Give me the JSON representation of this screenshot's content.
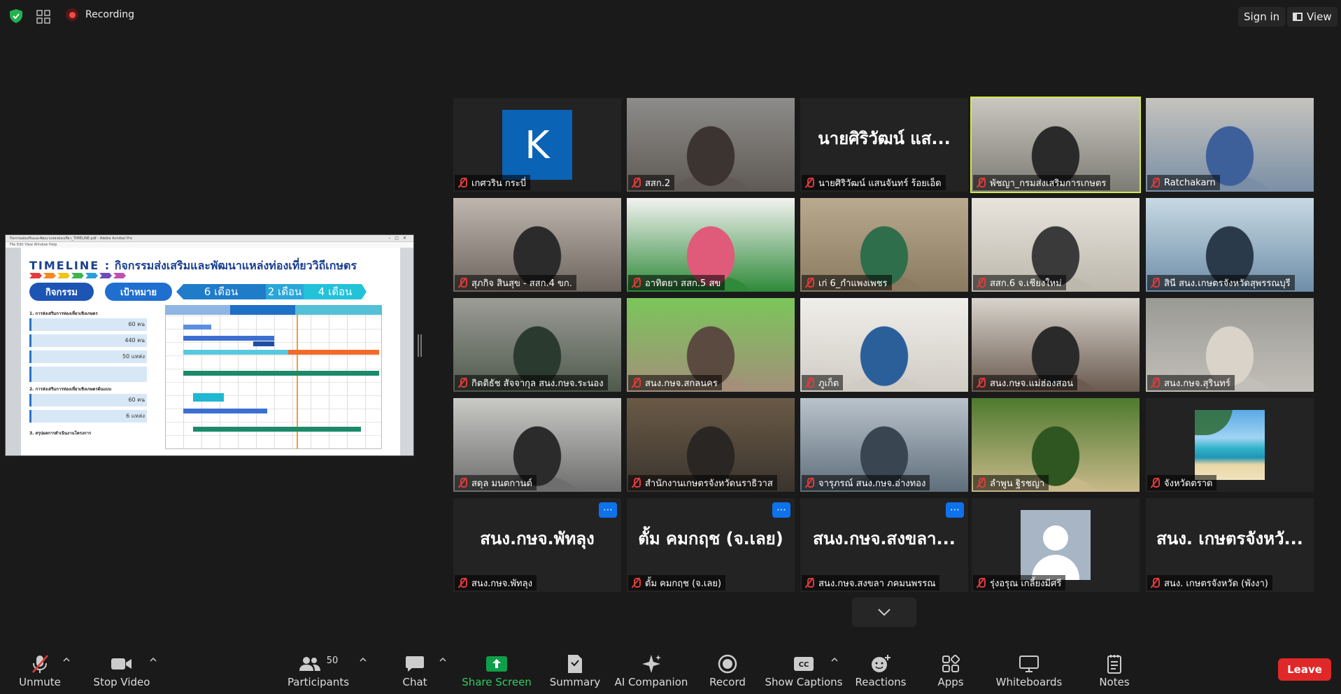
{
  "topbar": {
    "recording_label": "Recording",
    "signin_label": "Sign in",
    "view_label": "View"
  },
  "share": {
    "window_title": "กิจกรรมส่งเสริมและพัฒนาแหล่งท่องเที่ยว_TIMELINE.pdf - Adobe Acrobat Pro",
    "menu": "File  Edit  View  Window  Help",
    "slide_title_prefix": "TIMELINE :",
    "slide_title": "กิจกรรมส่งเสริมและพัฒนาแหล่งท่องเที่ยววิถีเกษตร",
    "pill_activity": "กิจกรรม",
    "pill_target": "เป้าหมาย",
    "band_6": "6 เดือน",
    "band_2": "2 เดือน",
    "band_4": "4 เดือน",
    "section1": "1. การส่งเสริมการท่องเที่ยวเชิงเกษตร",
    "row1_value": "60 คน",
    "row2_value": "440 คน",
    "row3_value": "50 แหล่ง",
    "section2": "2. การส่งเสริมการท่องเที่ยวเชิงเกษตรต้นแบบ",
    "row5_value": "60 คน",
    "row6_value": "6 แหล่ง",
    "section3": "3. สรุปผลการดำเนินงานโครงการ"
  },
  "tiles": [
    {
      "name": "เกศวริน กระบี่",
      "type": "avatar-letter",
      "letter": "K"
    },
    {
      "name": "สสก.2",
      "type": "video",
      "colors": [
        "#8d8c8a",
        "#5f5a55",
        "#3b3430"
      ]
    },
    {
      "name": "นายศิริวัฒน์ แสนจันทร์ ร้อยเอ็ด",
      "type": "name-only",
      "big": "นายศิริวัฒน์ แส..."
    },
    {
      "name": "พัชญา_กรมส่งเสริมการเกษตร",
      "type": "video",
      "active": true,
      "colors": [
        "#c9c7c0",
        "#7d7c74",
        "#2a2a2a"
      ]
    },
    {
      "name": "Ratchakarn",
      "type": "video",
      "colors": [
        "#c5c3bd",
        "#7a8fa6",
        "#3d5f9a"
      ]
    },
    {
      "name": "สุภกิจ สินสุข - สสก.4 ขก.",
      "type": "video",
      "colors": [
        "#bfb6ae",
        "#6d655e",
        "#2b2b2b"
      ]
    },
    {
      "name": "อาทิตยา สสก.5 สข",
      "type": "video",
      "colors": [
        "#f2f2f0",
        "#2f8a3a",
        "#e05a7a"
      ]
    },
    {
      "name": "เก่ 6_กำแพงเพชร",
      "type": "video",
      "colors": [
        "#b9a98e",
        "#8a7a60",
        "#2f6e4a"
      ]
    },
    {
      "name": "สสก.6 จ.เชียงใหม่",
      "type": "video",
      "colors": [
        "#e7e4dc",
        "#bdb8ad",
        "#3a3a3a"
      ]
    },
    {
      "name": "สินี สนง.เกษตรจังหวัดสุพรรณบุรี",
      "type": "video",
      "colors": [
        "#c7d9e4",
        "#6e8ea8",
        "#2a3a4a"
      ]
    },
    {
      "name": "กิตติธัช สัจจากุล สนง.กษจ.ระนอง",
      "type": "video",
      "colors": [
        "#9c9c96",
        "#4f5a4c",
        "#2b3a2f"
      ]
    },
    {
      "name": "สนง.กษจ.สกลนคร",
      "type": "video",
      "colors": [
        "#7ac65a",
        "#a48f7a",
        "#5a4a3f"
      ]
    },
    {
      "name": "ภูเก็ต",
      "type": "video",
      "colors": [
        "#f0eeea",
        "#d0ccc4",
        "#2a5f9a"
      ]
    },
    {
      "name": "สนง.กษจ.แม่ฮ่องสอน",
      "type": "video",
      "colors": [
        "#d8d4cc",
        "#6a5a4f",
        "#2a2a2a"
      ]
    },
    {
      "name": "สนง.กษจ.สุรินทร์",
      "type": "video",
      "colors": [
        "#9a9a94",
        "#c2bfb8",
        "#d9d3c9"
      ]
    },
    {
      "name": "สดุล มนตกานต์",
      "type": "video",
      "colors": [
        "#c9c9c6",
        "#6e6e6e",
        "#2b2b2b"
      ]
    },
    {
      "name": "สำนักงานเกษตรจังหวัดนราธิวาส",
      "type": "video",
      "colors": [
        "#6a5a46",
        "#3a342e",
        "#2a2624"
      ]
    },
    {
      "name": "จารุภรณ์ สนง.กษจ.อ่างทอง",
      "type": "video",
      "colors": [
        "#b9c3cc",
        "#5f6e7a",
        "#394550"
      ]
    },
    {
      "name": "ลำพูน ฐิรชญา",
      "type": "video",
      "colors": [
        "#4e7a2e",
        "#c9b98a",
        "#2f5520"
      ]
    },
    {
      "name": "จังหวัดตราด",
      "type": "avatar-beach"
    },
    {
      "name": "สนง.กษจ.พัทลุง",
      "type": "name-only",
      "big": "สนง.กษจ.พัทลุง",
      "menu": true
    },
    {
      "name": "ตั้ม คมกฤช (จ.เลย)",
      "type": "name-only",
      "big": "ตั้ม คมกฤช (จ.เลย)",
      "menu": true
    },
    {
      "name": "สนง.กษจ.สงขลา ภคมนพรรณ",
      "type": "name-only",
      "big": "สนง.กษจ.สงขลา...",
      "menu": true
    },
    {
      "name": "รุ่งอรุณ เกลี้ยงมีศรี",
      "type": "avatar-person"
    },
    {
      "name": "สนง. เกษตรจังหวัด (พังงา)",
      "type": "name-only",
      "big": "สนง. เกษตรจังหวั..."
    }
  ],
  "toolbar": {
    "unmute": "Unmute",
    "stop_video": "Stop Video",
    "participants": "Participants",
    "participants_count": "50",
    "chat": "Chat",
    "share_screen": "Share Screen",
    "summary": "Summary",
    "ai_companion": "AI Companion",
    "record": "Record",
    "show_captions": "Show Captions",
    "reactions": "Reactions",
    "apps": "Apps",
    "whiteboards": "Whiteboards",
    "notes": "Notes",
    "leave": "Leave"
  },
  "colors": {
    "accent_green": "#0e9f4a",
    "leave_red": "#e02828",
    "active_speaker": "#d4e84d",
    "muted_red": "#e03a3a"
  }
}
